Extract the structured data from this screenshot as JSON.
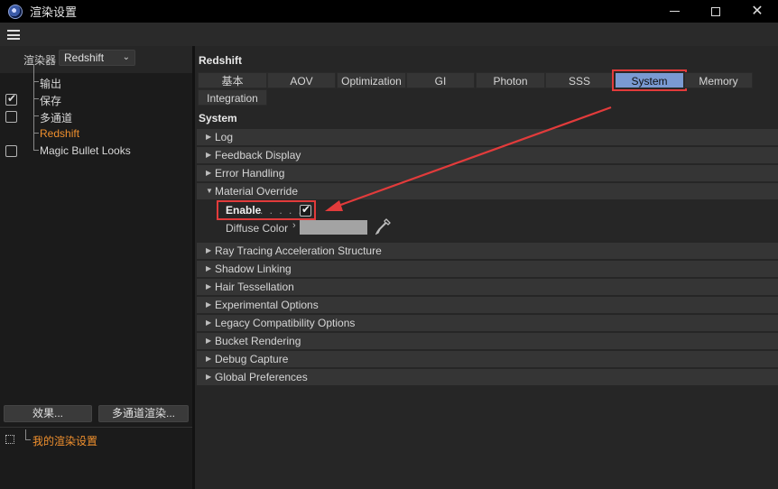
{
  "window": {
    "title": "渲染设置"
  },
  "renderer": {
    "label": "渲染器",
    "value": "Redshift"
  },
  "tree": [
    {
      "label": "输出",
      "checked": null,
      "active": false
    },
    {
      "label": "保存",
      "checked": true,
      "active": false
    },
    {
      "label": "多通道",
      "checked": false,
      "active": false
    },
    {
      "label": "Redshift",
      "checked": null,
      "active": true
    },
    {
      "label": "Magic Bullet Looks",
      "checked": false,
      "active": false
    }
  ],
  "left_buttons": {
    "effects": "效果...",
    "multipass_render": "多通道渲染..."
  },
  "presets": {
    "item": "我的渲染设置"
  },
  "panel": {
    "title": "Redshift",
    "section": "System",
    "tabs": [
      "基本",
      "AOV",
      "Optimization",
      "GI",
      "Photon",
      "SSS",
      "System",
      "Memory",
      "Integration"
    ],
    "active_tab": "System"
  },
  "groups": {
    "log": "Log",
    "feedback": "Feedback Display",
    "error": "Error Handling",
    "material_override": "Material Override",
    "ray_tracing": "Ray Tracing Acceleration Structure",
    "shadow": "Shadow Linking",
    "hair": "Hair Tessellation",
    "experimental": "Experimental Options",
    "legacy": "Legacy Compatibility Options",
    "bucket": "Bucket Rendering",
    "debug": "Debug Capture",
    "global": "Global Preferences"
  },
  "material_override": {
    "enable_label": "Enable",
    "enable_dots": ". . . . .",
    "enabled": true,
    "diffuse_label": "Diffuse Color",
    "diffuse_color": "#a3a3a3"
  },
  "colors": {
    "accent": "#f0902e",
    "active_tab": "#7a9ad2",
    "highlight": "#e23b3b"
  }
}
